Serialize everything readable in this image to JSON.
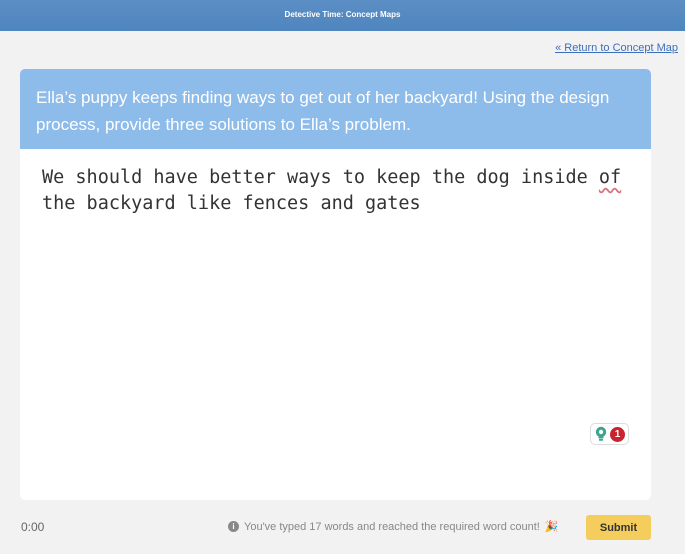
{
  "header": {
    "title": "Detective Time: Concept Maps"
  },
  "nav": {
    "return_link": "« Return to Concept Map"
  },
  "prompt": {
    "text": "Ella’s puppy keeps finding ways to get out of her backyard! Using the design process, provide three solutions to Ella’s problem."
  },
  "answer": {
    "before": "We should have better ways to keep the dog inside ",
    "flagged_word": "of",
    "after": " the backyard like fences and gates"
  },
  "hint_badge": {
    "icon": "lightbulb-icon",
    "count": "1"
  },
  "footer": {
    "timer": "0:00",
    "status_icon": "info-icon",
    "status_text": "You've typed 17 words and reached the required word count!",
    "status_emoji": "🎉",
    "submit_label": "Submit"
  },
  "colors": {
    "topbar": "#5b8ec4",
    "prompt_bg": "#8dbbea",
    "link": "#3b6fbd",
    "submit_bg": "#f4cd5d",
    "badge": "#c8242f",
    "spell_underline": "#d9707c"
  }
}
